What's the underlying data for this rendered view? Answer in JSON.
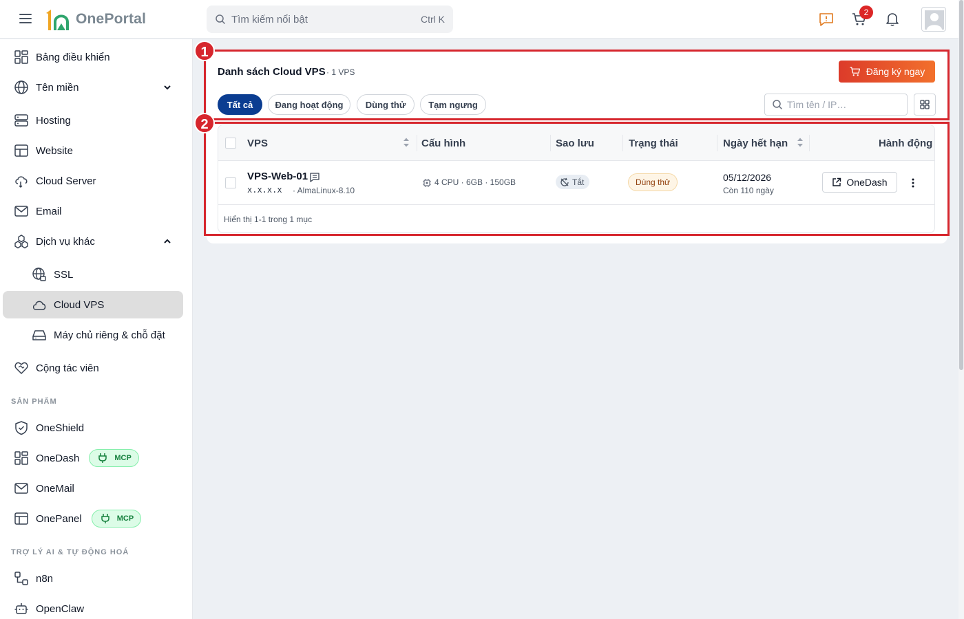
{
  "header": {
    "brand": "OnePortal",
    "search_placeholder": "Tìm kiếm nổi bật",
    "search_shortcut": "Ctrl K",
    "cart_count": "2"
  },
  "sidebar": {
    "items": [
      {
        "label": "Bảng điều khiển"
      },
      {
        "label": "Tên miền"
      },
      {
        "label": "Hosting"
      },
      {
        "label": "Website"
      },
      {
        "label": "Cloud Server"
      },
      {
        "label": "Email"
      },
      {
        "label": "Dịch vụ khác"
      },
      {
        "label": "SSL"
      },
      {
        "label": "Cloud VPS"
      },
      {
        "label": "Máy chủ riêng & chỗ đặt"
      },
      {
        "label": "Cộng tác viên"
      }
    ],
    "section_products": "SẢN PHẨM",
    "products": [
      {
        "label": "OneShield"
      },
      {
        "label": "OneDash",
        "badge": "MCP"
      },
      {
        "label": "OneMail"
      },
      {
        "label": "OnePanel",
        "badge": "MCP"
      }
    ],
    "section_ai": "TRỢ LÝ AI & TỰ ĐỘNG HOÁ",
    "ai_items": [
      {
        "label": "n8n"
      },
      {
        "label": "OpenClaw"
      }
    ]
  },
  "annotations": {
    "marker_1": "1",
    "marker_2": "2"
  },
  "main": {
    "title": "Danh sách Cloud VPS",
    "count": "· 1 VPS",
    "register_button": "Đăng ký ngay",
    "filters": [
      {
        "label": "Tất cả",
        "active": true
      },
      {
        "label": "Đang hoạt động"
      },
      {
        "label": "Dùng thử"
      },
      {
        "label": "Tạm ngưng"
      }
    ],
    "search_placeholder": "Tìm tên / IP…",
    "table": {
      "columns": [
        "VPS",
        "Cấu hình",
        "Sao lưu",
        "Trạng thái",
        "Ngày hết hạn",
        "Hành động"
      ],
      "rows": [
        {
          "name": "VPS-Web-01",
          "ip": "x.x.x.x",
          "os": "· AlmaLinux-8.10",
          "config": "4 CPU · 6GB · 150GB",
          "backup": "Tắt",
          "status": "Dùng thử",
          "expiry": "05/12/2026",
          "remaining": "Còn 110 ngày",
          "action": "OneDash"
        }
      ],
      "footer": "Hiển thị 1-1 trong 1 mục"
    }
  }
}
